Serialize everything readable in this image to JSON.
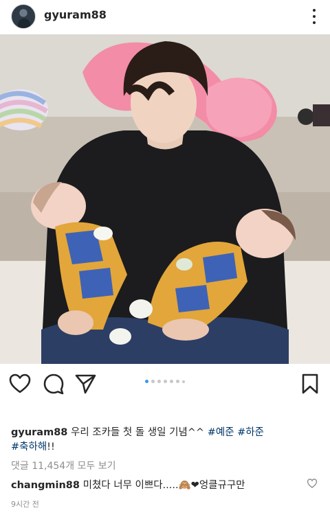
{
  "header": {
    "username": "gyuram88",
    "avatar_icon": "profile-avatar"
  },
  "post": {
    "carousel": {
      "total": 7,
      "active_index": 0
    },
    "caption": {
      "username": "gyuram88",
      "text": "우리 조카들 첫 돌 생일 기념^^",
      "hashtags": [
        "#예준",
        "#하준",
        "#축하해"
      ],
      "suffix": "!!"
    },
    "comments_link": "댓글 11,454개 모두 보기",
    "top_comment": {
      "username": "changmin88",
      "text": "미쳤다 너무 이쁘다.....",
      "emoji": "🙈❤",
      "text_after": "엉클규구만"
    },
    "timestamp": "9시간 전"
  },
  "icons": {
    "like": "heart-outline-icon",
    "comment": "speech-bubble-icon",
    "share": "paper-plane-icon",
    "save": "bookmark-icon",
    "more": "more-vertical-icon"
  },
  "colors": {
    "text": "#262626",
    "muted": "#8e8e8e",
    "hashtag": "#003569",
    "carousel_active": "#3897f0",
    "carousel_inactive": "#c7c7c7"
  }
}
